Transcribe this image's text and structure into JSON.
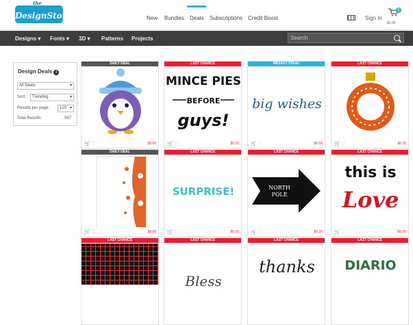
{
  "brand": {
    "logo_small": "the",
    "logo_main": "DesignStore"
  },
  "top_nav": [
    "New",
    "Bundles",
    "Deals",
    "Subscriptions",
    "Credit Boost"
  ],
  "active_nav": "Deals",
  "header": {
    "sign_in": "Sign In",
    "cart_count": "0",
    "cart_price": "$0.00"
  },
  "main_nav": [
    "Designs",
    "Fonts",
    "3D",
    "Patterns",
    "Projects"
  ],
  "search": {
    "placeholder": "Search"
  },
  "sidebar": {
    "title": "Design Deals",
    "filter_value": "All Deals",
    "sort_label": "Sort:",
    "sort_value": "Trending",
    "per_page_label": "Results per page:",
    "per_page_value": "120",
    "total_label": "Total Results:",
    "total_value": "967"
  },
  "cards": [
    {
      "banner": "DAILY DEAL",
      "price": "$0.69",
      "art": "penguin"
    },
    {
      "banner": "LAST CHANCE",
      "price": "$0.25",
      "art": "mince"
    },
    {
      "banner": "WEEKLY STEAL",
      "price": "$0.50",
      "art": "bigwishes"
    },
    {
      "banner": "LAST CHANCE",
      "price": "$0.25",
      "art": "ornament"
    },
    {
      "banner": "DAILY DEAL",
      "price": "$0.69",
      "art": "floral"
    },
    {
      "banner": "LAST CHANCE",
      "price": "$0.25",
      "art": "surprise"
    },
    {
      "banner": "LAST CHANCE",
      "price": "$0.25",
      "art": "northpole"
    },
    {
      "banner": "LAST CHANCE",
      "price": "$0.25",
      "art": "love"
    },
    {
      "banner": "LAST CHANCE",
      "price": "",
      "art": "pattern"
    },
    {
      "banner": "LAST CHANCE",
      "price": "",
      "art": "script1"
    },
    {
      "banner": "LAST CHANCE",
      "price": "",
      "art": "thanks"
    },
    {
      "banner": "LAST CHANCE",
      "price": "",
      "art": "diario"
    }
  ],
  "art_text": {
    "mince_1": "MINCE PIES",
    "mince_2": "BEFORE",
    "mince_3": "guys!",
    "bigwishes": "big wishes",
    "surprise": "SURPRISE!",
    "north": "NORTH",
    "pole": "POLE",
    "love_1": "this is",
    "love_2": "Love",
    "thanks": "thanks",
    "script": "Bless",
    "diario": "DIARIO"
  },
  "colors": {
    "accent": "#2bb3d9",
    "last_chance": "#ed1c2e",
    "daily": "#555555",
    "nav_bg": "#3d3d3d"
  }
}
